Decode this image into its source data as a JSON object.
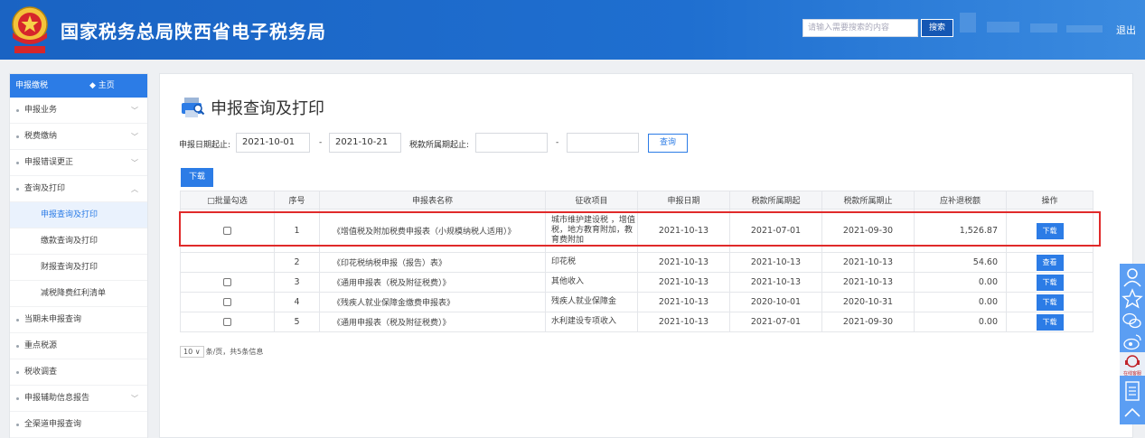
{
  "header": {
    "title": "国家税务总局陕西省电子税务局",
    "search_placeholder": "请输入需要搜索的内容",
    "search_label": "搜索",
    "logout_label": "退出",
    "colors": {
      "primary": "#1f6fd0",
      "accent": "#2c7ce6",
      "highlight": "#e02a2a"
    }
  },
  "sidebar": {
    "section": "申报缴税",
    "home_label": "◆ 主页",
    "items": [
      {
        "label": "申报业务",
        "chevron": true
      },
      {
        "label": "税费缴纳",
        "chevron": true
      },
      {
        "label": "申报错误更正",
        "chevron": true
      },
      {
        "label": "查询及打印",
        "chevron": true
      }
    ],
    "subitems": [
      {
        "label": "申报查询及打印",
        "active": true
      },
      {
        "label": "缴款查询及打印"
      },
      {
        "label": "财报查询及打印"
      },
      {
        "label": "减税降费红利清单"
      }
    ],
    "items_after": [
      {
        "label": "当期未申报查询",
        "chevron": false
      },
      {
        "label": "重点税源",
        "chevron": false
      },
      {
        "label": "税收调查",
        "chevron": false
      },
      {
        "label": "申报辅助信息报告",
        "chevron": true
      },
      {
        "label": "全渠道申报查询",
        "chevron": false
      }
    ]
  },
  "main": {
    "title": "申报查询及打印",
    "filters": {
      "date_label": "申报日期起止:",
      "date_from": "2021-10-01",
      "separator": "-",
      "date_to": "2021-10-21",
      "period_label": "税款所属期起止:",
      "period_from": "",
      "period_to": "",
      "query_label": "查询"
    },
    "download_label": "下载",
    "table": {
      "headers": [
        "□批量勾选",
        "序号",
        "申报表名称",
        "征收项目",
        "申报日期",
        "税款所属期起",
        "税款所属期止",
        "应补退税额",
        "操作"
      ],
      "rows": [
        {
          "checkbox": true,
          "no": "1",
          "name": "《增值税及附加税费申报表（小规模纳税人适用）》",
          "item": "城市维护建设税 ，增值税，地方教育附加，教育费附加",
          "date": "2021-10-13",
          "start": "2021-07-01",
          "end": "2021-09-30",
          "amount": "1,526.87",
          "action": "下载",
          "highlight": true
        },
        {
          "checkbox": false,
          "no": "2",
          "name": "《印花税纳税申报（报告）表》",
          "item": "印花税",
          "date": "2021-10-13",
          "start": "2021-10-13",
          "end": "2021-10-13",
          "amount": "54.60",
          "action": "查看"
        },
        {
          "checkbox": true,
          "no": "3",
          "name": "《通用申报表（税及附征税费）》",
          "item": "其他收入",
          "date": "2021-10-13",
          "start": "2021-10-13",
          "end": "2021-10-13",
          "amount": "0.00",
          "action": "下载"
        },
        {
          "checkbox": true,
          "no": "4",
          "name": "《残疾人就业保障金缴费申报表》",
          "item": "残疾人就业保障金",
          "date": "2021-10-13",
          "start": "2020-10-01",
          "end": "2020-10-31",
          "amount": "0.00",
          "action": "下载"
        },
        {
          "checkbox": true,
          "no": "5",
          "name": "《通用申报表（税及附征税费）》",
          "item": "水利建设专项收入",
          "date": "2021-10-13",
          "start": "2021-07-01",
          "end": "2021-09-30",
          "amount": "0.00",
          "action": "下载"
        }
      ]
    },
    "pager": {
      "page_size": "10",
      "text": "条/页，共5条信息"
    }
  },
  "rail": {
    "online_service_label": "在线客服",
    "icons": [
      "user-icon",
      "star-icon",
      "wechat-icon",
      "weibo-icon",
      "headset-icon",
      "document-icon",
      "back-to-top-icon"
    ]
  }
}
